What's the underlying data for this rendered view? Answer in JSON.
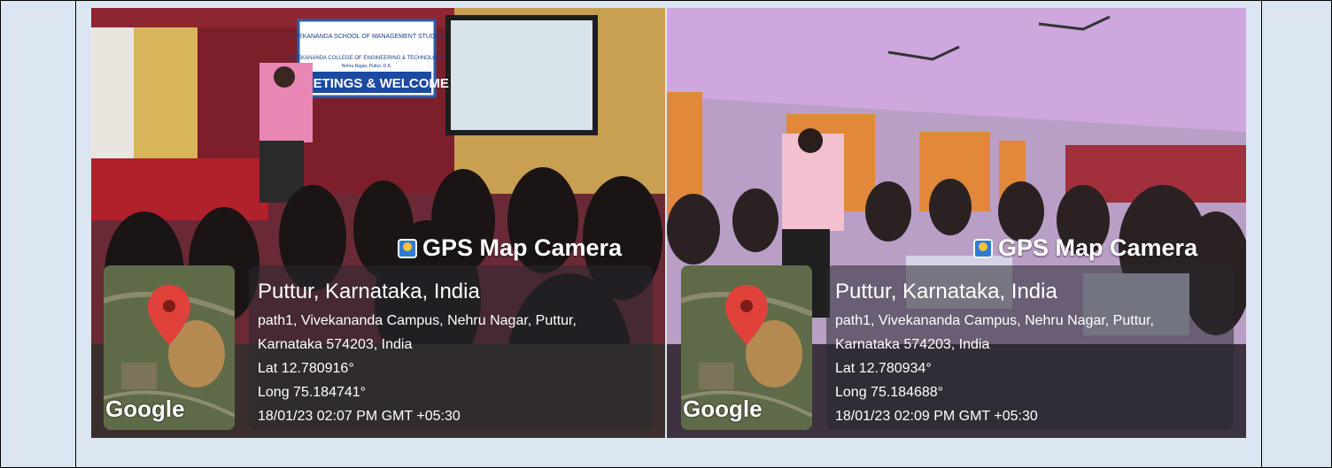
{
  "photos": [
    {
      "gps_badge": "GPS Map Camera",
      "location_title": "Puttur, Karnataka, India",
      "address_line1": "path1, Vivekananda Campus, Nehru Nagar, Puttur,",
      "address_line2": "Karnataka 574203, India",
      "latitude": "Lat 12.780916°",
      "longitude": "Long 75.184741°",
      "timestamp": "18/01/23 02:07 PM GMT +05:30",
      "map_brand": "Google",
      "banner_line1": "VIVEKANANDA SCHOOL OF MANAGEMENT STUDIES",
      "banner_line2": "VIVEKANANDA COLLEGE OF ENGINEERING & TECHNOLOGY",
      "banner_line3": "Nehru Nagar, Puttur, D.K.",
      "banner_line4": "GREETINGS & WELCOME"
    },
    {
      "gps_badge": "GPS Map Camera",
      "location_title": "Puttur, Karnataka, India",
      "address_line1": "path1, Vivekananda Campus, Nehru Nagar, Puttur,",
      "address_line2": "Karnataka 574203, India",
      "latitude": "Lat 12.780934°",
      "longitude": "Long 75.184688°",
      "timestamp": "18/01/23 02:09 PM GMT +05:30",
      "map_brand": "Google"
    }
  ]
}
